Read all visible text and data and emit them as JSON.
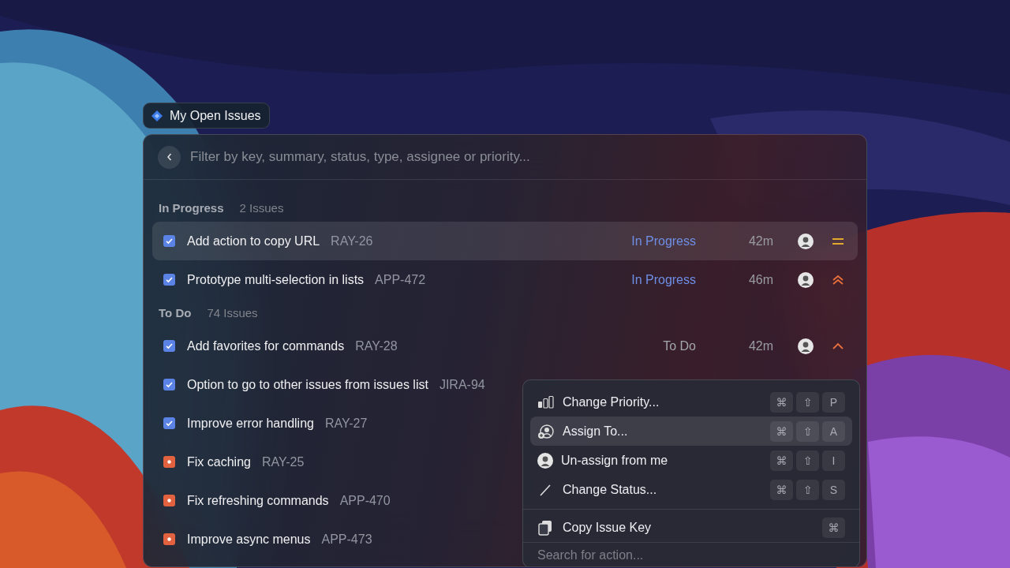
{
  "tag": {
    "title": "My Open Issues"
  },
  "search": {
    "placeholder": "Filter by key, summary, status, type, assignee or priority..."
  },
  "sections": [
    {
      "title": "In Progress",
      "count": "2 Issues",
      "issues": [
        {
          "kind": "task",
          "title": "Add action to copy URL",
          "key": "RAY-26",
          "selected": true,
          "status": "In Progress",
          "color": "#6f8fe6",
          "age": "42m",
          "priority": {
            "kind": "medium"
          }
        },
        {
          "kind": "task",
          "title": "Prototype multi-selection in lists",
          "key": "APP-472",
          "selected": false,
          "status": "In Progress",
          "color": "#6f8fe6",
          "age": "46m",
          "priority": {
            "kind": "highest"
          }
        }
      ]
    },
    {
      "title": "To Do",
      "count": "74 Issues",
      "issues": [
        {
          "kind": "task",
          "title": "Add favorites for commands",
          "key": "RAY-28",
          "selected": false,
          "status": "To Do",
          "color": "#a4a6ae",
          "age": "42m",
          "priority": {
            "kind": "high"
          }
        },
        {
          "kind": "task",
          "title": "Option to go to other issues from issues list",
          "key": "JIRA-94",
          "selected": false
        },
        {
          "kind": "task",
          "title": "Improve error handling",
          "key": "RAY-27",
          "selected": false
        },
        {
          "kind": "bug",
          "title": "Fix caching",
          "key": "RAY-25",
          "selected": false
        },
        {
          "kind": "bug",
          "title": "Fix refreshing commands",
          "key": "APP-470",
          "selected": false
        },
        {
          "kind": "bug",
          "title": "Improve async menus",
          "key": "APP-473",
          "selected": false
        }
      ]
    }
  ],
  "action_menu": {
    "groups": [
      {
        "items": [
          {
            "kind": "priority",
            "label": "Change Priority...",
            "keys": [
              "⌘",
              "⇧",
              "P"
            ],
            "selected": false
          },
          {
            "kind": "assign",
            "label": "Assign To...",
            "keys": [
              "⌘",
              "⇧",
              "A"
            ],
            "selected": true
          },
          {
            "kind": "avatar",
            "label": "Un-assign from me",
            "keys": [
              "⌘",
              "⇧",
              "I"
            ],
            "selected": false
          },
          {
            "kind": "status",
            "label": "Change Status...",
            "keys": [
              "⌘",
              "⇧",
              "S"
            ],
            "selected": false
          }
        ]
      },
      {
        "items": [
          {
            "kind": "copy",
            "label": "Copy Issue Key",
            "keys": [
              "⌘"
            ],
            "selected": false
          }
        ]
      }
    ],
    "search": {
      "placeholder": "Search for action..."
    }
  }
}
